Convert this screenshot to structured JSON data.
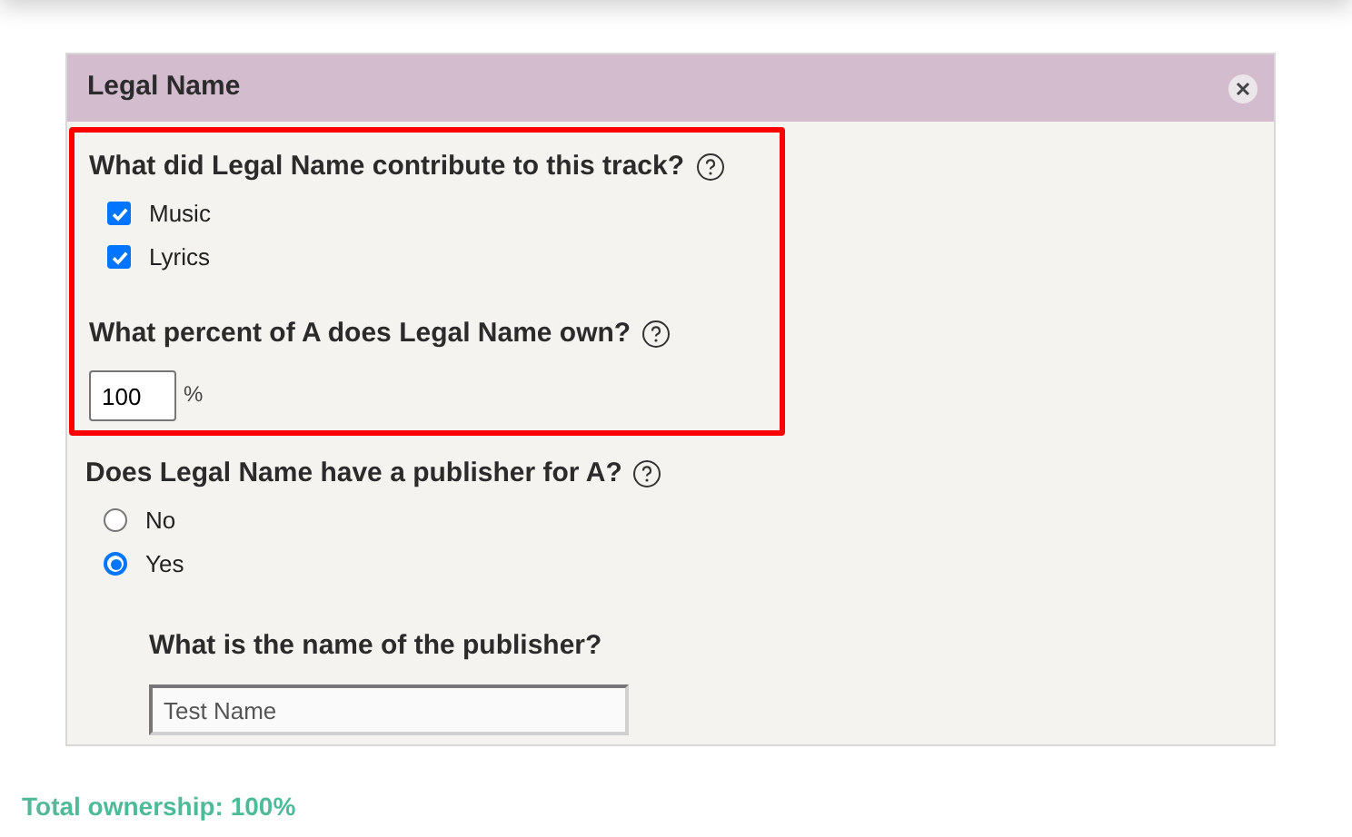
{
  "panel": {
    "title": "Legal Name",
    "highlighted_questions": [
      {
        "kind": "checkboxes",
        "question": "What did Legal Name contribute to this track?",
        "options": [
          {
            "label": "Music",
            "checked": true
          },
          {
            "label": "Lyrics",
            "checked": true
          }
        ]
      },
      {
        "kind": "percent",
        "question": "What percent of A does Legal Name own?",
        "value": "100",
        "unit": "%"
      }
    ],
    "publisher_question": {
      "question": "Does Legal Name have a publisher for A?",
      "options": [
        {
          "label": "No",
          "selected": false
        },
        {
          "label": "Yes",
          "selected": true
        }
      ]
    },
    "publisher_name": {
      "question": "What is the name of the publisher?",
      "value": "Test Name"
    }
  },
  "total": "Total ownership: 100%"
}
